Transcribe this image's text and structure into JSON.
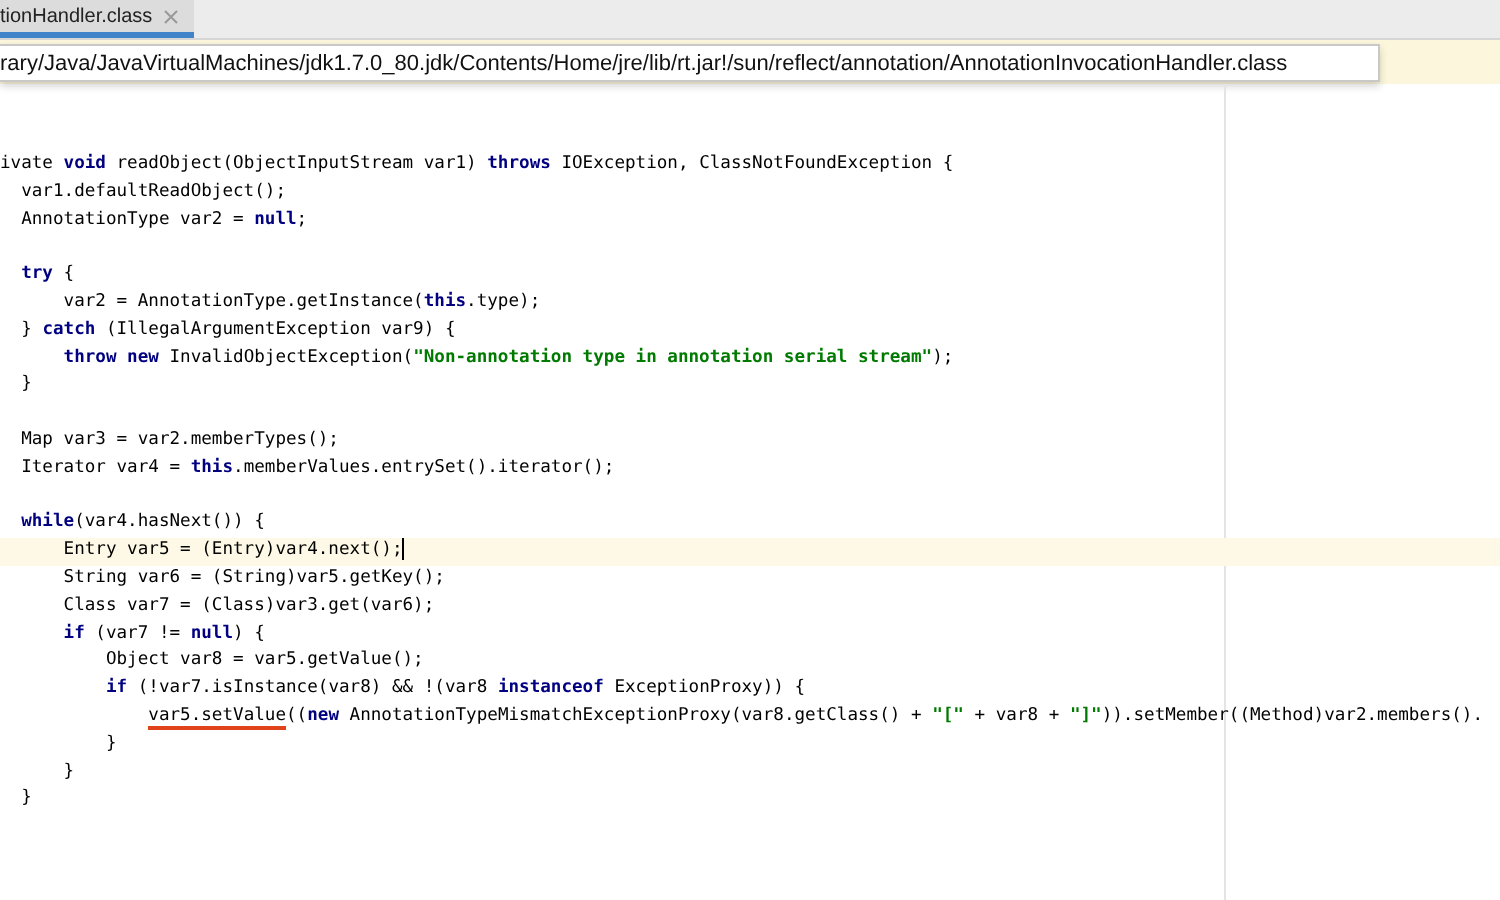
{
  "tab": {
    "label": "tionHandler.class",
    "selected": true
  },
  "path_tooltip": {
    "text": "rary/Java/JavaVirtualMachines/jdk1.7.0_80.jdk/Contents/Home/jre/lib/rt.jar!/sun/reflect/annotation/AnnotationInvocationHandler.class"
  },
  "code_lines": [
    {
      "current": false,
      "segments": [
        {
          "kind": "plain",
          "text": "ivate "
        },
        {
          "kind": "keyword",
          "text": "void"
        },
        {
          "kind": "plain",
          "text": " readObject(ObjectInputStream var1) "
        },
        {
          "kind": "keyword",
          "text": "throws"
        },
        {
          "kind": "plain",
          "text": " IOException, ClassNotFoundException {"
        }
      ]
    },
    {
      "current": false,
      "segments": [
        {
          "kind": "plain",
          "text": "  var1.defaultReadObject();"
        }
      ]
    },
    {
      "current": false,
      "segments": [
        {
          "kind": "plain",
          "text": "  AnnotationType var2 = "
        },
        {
          "kind": "keyword",
          "text": "null"
        },
        {
          "kind": "plain",
          "text": ";"
        }
      ]
    },
    {
      "current": false
    },
    {
      "current": false,
      "segments": [
        {
          "kind": "keyword",
          "text": "  try"
        },
        {
          "kind": "plain",
          "text": " {"
        }
      ]
    },
    {
      "current": false,
      "segments": [
        {
          "kind": "plain",
          "text": "      var2 = AnnotationType.getInstance("
        },
        {
          "kind": "keyword",
          "text": "this"
        },
        {
          "kind": "plain",
          "text": ".type);"
        }
      ]
    },
    {
      "current": false,
      "segments": [
        {
          "kind": "plain",
          "text": "  } "
        },
        {
          "kind": "keyword",
          "text": "catch"
        },
        {
          "kind": "plain",
          "text": " (IllegalArgumentException var9) {"
        }
      ]
    },
    {
      "current": false,
      "segments": [
        {
          "kind": "keyword",
          "text": "      throw new"
        },
        {
          "kind": "plain",
          "text": " InvalidObjectException("
        },
        {
          "kind": "string",
          "text": "\"Non-annotation type in annotation serial stream\""
        },
        {
          "kind": "plain",
          "text": ");"
        }
      ]
    },
    {
      "current": false,
      "segments": [
        {
          "kind": "plain",
          "text": "  }"
        }
      ]
    },
    {
      "current": false
    },
    {
      "current": false,
      "segments": [
        {
          "kind": "plain",
          "text": "  Map var3 = var2.memberTypes();"
        }
      ]
    },
    {
      "current": false,
      "segments": [
        {
          "kind": "plain",
          "text": "  Iterator var4 = "
        },
        {
          "kind": "keyword",
          "text": "this"
        },
        {
          "kind": "plain",
          "text": ".memberValues.entrySet().iterator();"
        }
      ]
    },
    {
      "current": false
    },
    {
      "current": false,
      "segments": [
        {
          "kind": "keyword",
          "text": "  while"
        },
        {
          "kind": "plain",
          "text": "(var4.hasNext()) {"
        }
      ]
    },
    {
      "current": true,
      "segments": [
        {
          "kind": "plain",
          "text": "      Entry var5 = (Entry)var4.next();"
        }
      ]
    },
    {
      "current": false,
      "segments": [
        {
          "kind": "plain",
          "text": "      String var6 = (String)var5.getKey();"
        }
      ]
    },
    {
      "current": false,
      "segments": [
        {
          "kind": "plain",
          "text": "      Class var7 = (Class)var3.get(var6);"
        }
      ]
    },
    {
      "current": false,
      "segments": [
        {
          "kind": "keyword",
          "text": "      if"
        },
        {
          "kind": "plain",
          "text": " (var7 != "
        },
        {
          "kind": "keyword",
          "text": "null"
        },
        {
          "kind": "plain",
          "text": ") {"
        }
      ]
    },
    {
      "current": false,
      "segments": [
        {
          "kind": "plain",
          "text": "          Object var8 = var5.getValue();"
        }
      ]
    },
    {
      "current": false,
      "segments": [
        {
          "kind": "keyword",
          "text": "          if"
        },
        {
          "kind": "plain",
          "text": " (!var7.isInstance(var8) && !(var8 "
        },
        {
          "kind": "keyword",
          "text": "instanceof"
        },
        {
          "kind": "plain",
          "text": " ExceptionProxy)) {"
        }
      ]
    },
    {
      "current": false,
      "segments": [
        {
          "kind": "underlined",
          "text": "              var5.setValue"
        },
        {
          "kind": "plain",
          "text": "(("
        },
        {
          "kind": "keyword",
          "text": "new"
        },
        {
          "kind": "plain",
          "text": " AnnotationTypeMismatchExceptionProxy(var8.getClass() + "
        },
        {
          "kind": "string",
          "text": "\"[\""
        },
        {
          "kind": "plain",
          "text": " + var8 + "
        },
        {
          "kind": "string",
          "text": "\"]\""
        },
        {
          "kind": "plain",
          "text": ")).setMember((Method)var2.members()."
        }
      ]
    },
    {
      "current": false,
      "segments": [
        {
          "kind": "plain",
          "text": "          }"
        }
      ]
    },
    {
      "current": false,
      "segments": [
        {
          "kind": "plain",
          "text": "      }"
        }
      ]
    },
    {
      "current": false,
      "segments": [
        {
          "kind": "plain",
          "text": "  }"
        }
      ]
    }
  ]
}
